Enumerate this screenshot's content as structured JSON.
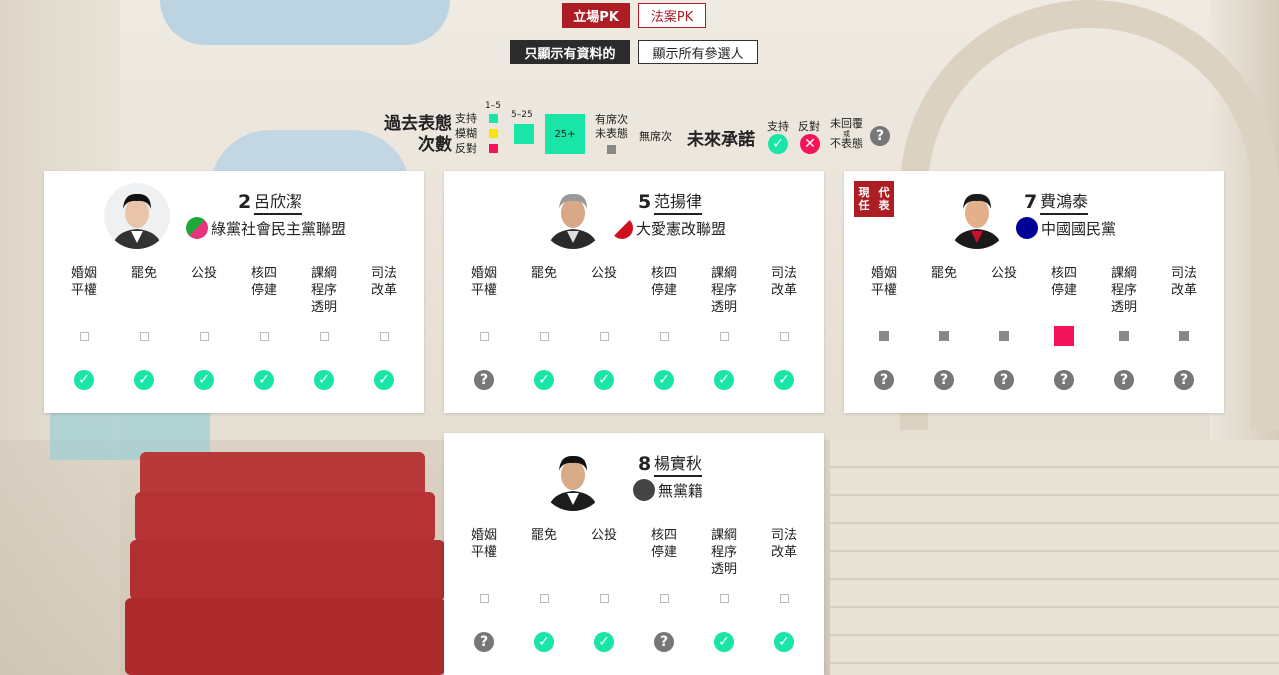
{
  "toggles": {
    "stance_pk": "立場PK",
    "bill_pk": "法案PK"
  },
  "filters": {
    "with_data": "只顯示有資料的",
    "all": "顯示所有參選人"
  },
  "legend": {
    "past_title_1": "過去表態",
    "past_title_2": "次數",
    "support": "支持",
    "ambiguous": "模糊",
    "oppose": "反對",
    "range_small": "1–5",
    "range_mid": "5–25",
    "range_large": "25+",
    "present_no_stance_1": "有席次",
    "present_no_stance_2": "未表態",
    "absent": "無席次",
    "future_title": "未來承諾",
    "future_support": "支持",
    "future_oppose": "反對",
    "future_unknown_1": "未回覆",
    "future_unknown_or": "或",
    "future_unknown_2": "不表態",
    "colors": {
      "support": "#19e5a6",
      "ambiguous": "#f5e50c",
      "oppose": "#f4145b",
      "absent": "#888888"
    }
  },
  "issues": [
    {
      "line1": "婚姻",
      "line2": "平權",
      "line3": ""
    },
    {
      "line1": "罷免",
      "line2": "",
      "line3": ""
    },
    {
      "line1": "公投",
      "line2": "",
      "line3": ""
    },
    {
      "line1": "核四",
      "line2": "停建",
      "line3": ""
    },
    {
      "line1": "課綱",
      "line2": "程序",
      "line3": "透明"
    },
    {
      "line1": "司法",
      "line2": "改革",
      "line3": ""
    }
  ],
  "candidates": [
    {
      "number": "2",
      "name": "呂欣潔",
      "party": "綠黨社會民主黨聯盟",
      "party_colors": [
        "#1fa83a",
        "#e8347c"
      ],
      "badge": "",
      "past": [
        "none",
        "none",
        "none",
        "none",
        "none",
        "none"
      ],
      "future": [
        "support",
        "support",
        "support",
        "support",
        "support",
        "support"
      ]
    },
    {
      "number": "5",
      "name": "范揚律",
      "party": "大愛憲改聯盟",
      "party_colors": [
        "#ffffff",
        "#d0111b"
      ],
      "badge": "",
      "past": [
        "none",
        "none",
        "none",
        "none",
        "none",
        "none"
      ],
      "future": [
        "unknown",
        "support",
        "support",
        "support",
        "support",
        "support"
      ]
    },
    {
      "number": "7",
      "name": "費鴻泰",
      "party": "中國國民黨",
      "party_colors": [
        "#000099",
        "#000099"
      ],
      "badge": "現任代表",
      "badge_line1": "現任",
      "badge_line2": "代表",
      "past": [
        "absent",
        "absent",
        "absent",
        "oppose",
        "absent",
        "absent"
      ],
      "future": [
        "unknown",
        "unknown",
        "unknown",
        "unknown",
        "unknown",
        "unknown"
      ]
    },
    {
      "number": "8",
      "name": "楊實秋",
      "party": "無黨籍",
      "party_colors": [
        "#444444",
        "#444444"
      ],
      "badge": "",
      "past": [
        "none",
        "none",
        "none",
        "none",
        "none",
        "none"
      ],
      "future": [
        "unknown",
        "support",
        "support",
        "unknown",
        "support",
        "support"
      ]
    }
  ]
}
